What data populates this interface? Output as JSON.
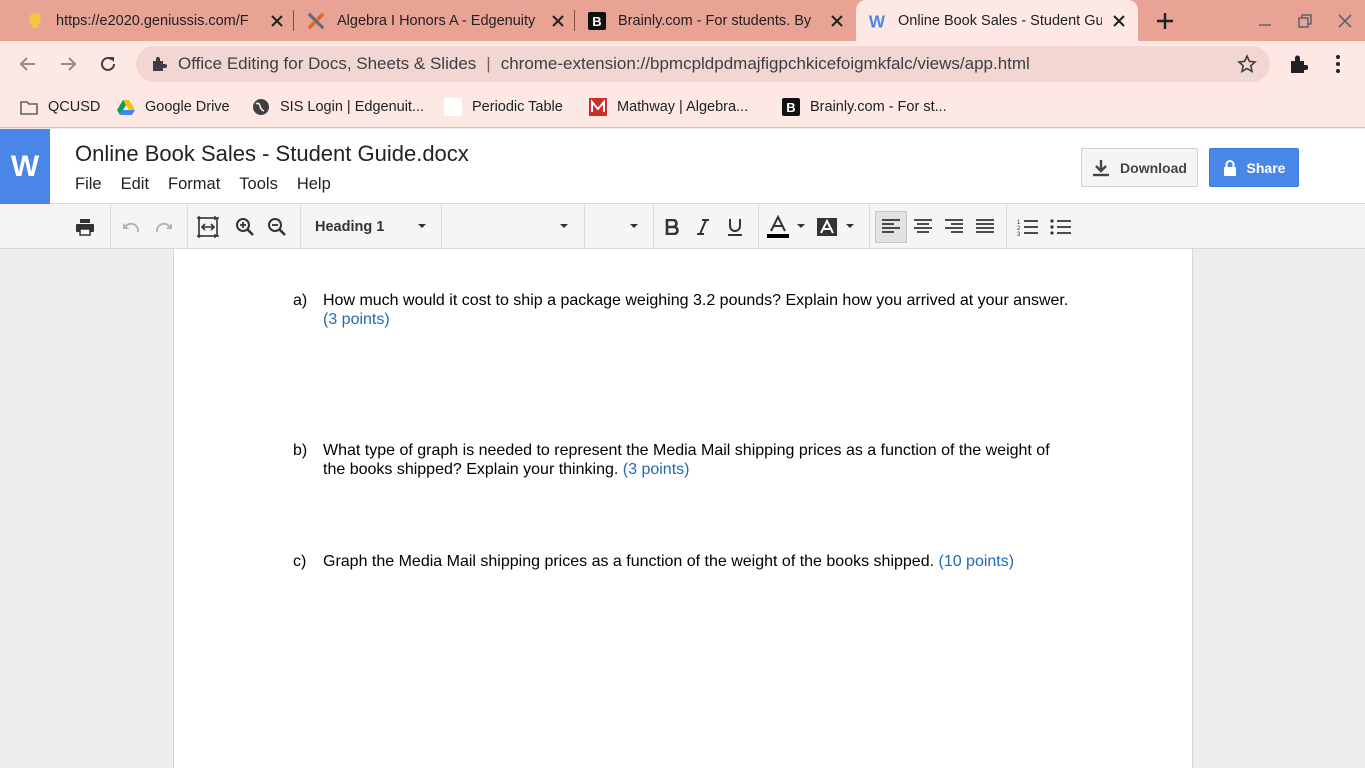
{
  "browser": {
    "tabs": [
      {
        "title": "https://e2020.geniussis.com/F",
        "icon": "lightbulb-icon"
      },
      {
        "title": "Algebra I Honors A - Edgenuity",
        "icon": "edgenuity-icon"
      },
      {
        "title": "Brainly.com - For students. By",
        "icon": "brainly-icon"
      },
      {
        "title": "Online Book Sales - Student Gu",
        "icon": "word-icon",
        "active": true
      }
    ],
    "omnibox": {
      "extension_name": "Office Editing for Docs, Sheets & Slides",
      "separator": "|",
      "url": "chrome-extension://bpmcpldpdmajfigpchkicefoigmkfalc/views/app.html"
    },
    "bookmarks": [
      {
        "label": "QCUSD",
        "icon": "folder-icon"
      },
      {
        "label": "Google Drive",
        "icon": "google-drive-icon"
      },
      {
        "label": "SIS Login | Edgenuit...",
        "icon": "globe-icon"
      },
      {
        "label": "Periodic Table",
        "icon": "blank-page-icon"
      },
      {
        "label": "Mathway | Algebra...",
        "icon": "mathway-icon"
      },
      {
        "label": "Brainly.com - For st...",
        "icon": "brainly-icon"
      }
    ]
  },
  "app": {
    "logo_letter": "W",
    "title": "Online Book Sales - Student Guide.docx",
    "menu": [
      "File",
      "Edit",
      "Format",
      "Tools",
      "Help"
    ],
    "download_label": "Download",
    "share_label": "Share",
    "accent_color": "#4a86e8"
  },
  "toolbar": {
    "style_value": "Heading 1",
    "font_value": "",
    "size_value": ""
  },
  "document": {
    "questions": [
      {
        "label": "a)",
        "text": "How much would it cost to ship a package weighing 3.2 pounds? Explain how you arrived at your answer.",
        "points": "(3 points)"
      },
      {
        "label": "b)",
        "text": "What type of graph is needed to represent the Media Mail shipping prices as a function of the weight of the books shipped? Explain your thinking.",
        "points": "(3 points)"
      },
      {
        "label": "c)",
        "text": "Graph the Media Mail shipping prices as a function of the weight of the books shipped.",
        "points": "(10 points)"
      }
    ],
    "points_color": "#1f6bb4"
  }
}
